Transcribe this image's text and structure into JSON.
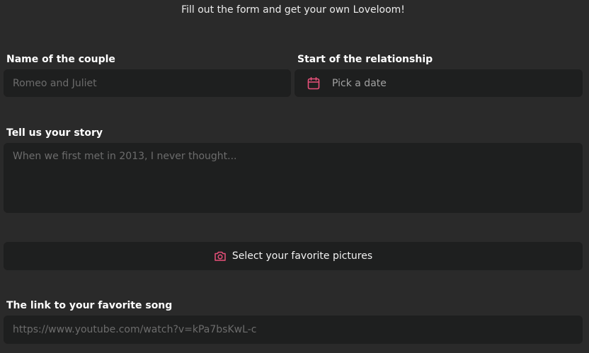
{
  "intro": "Fill out the form and get your own Loveloom!",
  "couple": {
    "label": "Name of the couple",
    "placeholder": "Romeo and Juliet"
  },
  "relationship_start": {
    "label": "Start of the relationship",
    "button_text": "Pick a date",
    "icon": "calendar-icon"
  },
  "story": {
    "label": "Tell us your story",
    "placeholder": "When we first met in 2013, I never thought..."
  },
  "pictures": {
    "button_text": "Select your favorite pictures",
    "icon": "camera-icon"
  },
  "song": {
    "label": "The link to your favorite song",
    "placeholder": "https://www.youtube.com/watch?v=kPa7bsKwL-c"
  },
  "colors": {
    "background": "#2a2a2a",
    "field_background": "#1e1f1f",
    "accent": "#e8507a",
    "placeholder": "#6c6c6c"
  }
}
